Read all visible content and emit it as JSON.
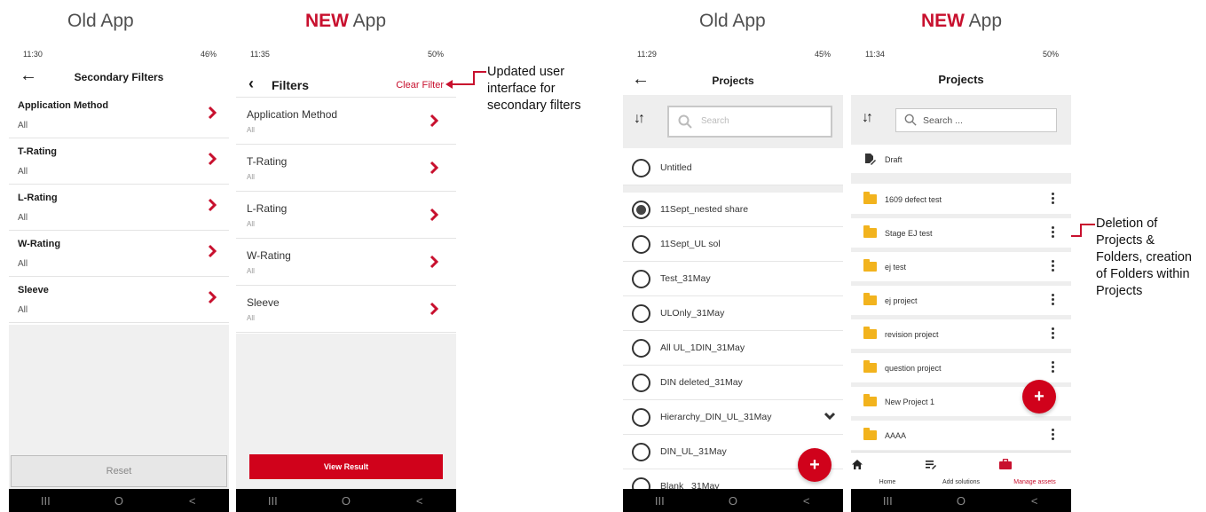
{
  "captions": {
    "c1": "Old App",
    "c2_new": "NEW",
    "c2_rest": " App",
    "c3": "Old App",
    "c4_new": "NEW",
    "c4_rest": " App"
  },
  "colors": {
    "accent": "#c8102e",
    "button_red": "#d0021b",
    "folder": "#f2b31d"
  },
  "old_filters": {
    "time": "11:30",
    "status_right": "46%",
    "title": "Secondary Filters",
    "items": [
      {
        "label": "Application Method",
        "value": "All"
      },
      {
        "label": "T-Rating",
        "value": "All"
      },
      {
        "label": "L-Rating",
        "value": "All"
      },
      {
        "label": "W-Rating",
        "value": "All"
      },
      {
        "label": "Sleeve",
        "value": "All"
      }
    ],
    "reset_label": "Reset"
  },
  "new_filters": {
    "time": "11:35",
    "status_right": "50%",
    "title": "Filters",
    "clear_label": "Clear Filter",
    "items": [
      {
        "label": "Application Method",
        "value": "All"
      },
      {
        "label": "T-Rating",
        "value": "All"
      },
      {
        "label": "L-Rating",
        "value": "All"
      },
      {
        "label": "W-Rating",
        "value": "All"
      },
      {
        "label": "Sleeve",
        "value": "All"
      }
    ],
    "view_result_label": "View Result"
  },
  "annotations": {
    "filters_note": [
      "Updated user",
      "interface for",
      "secondary filters"
    ],
    "projects_note": [
      "Deletion of",
      "Projects &",
      "Folders, creation",
      "of Folders within",
      "Projects"
    ]
  },
  "old_projects": {
    "time": "11:29",
    "status_right": "45%",
    "title": "Projects",
    "search_placeholder": "Search",
    "items": [
      {
        "label": "Untitled",
        "selected": false
      },
      {
        "label": "11Sept_nested share",
        "selected": true
      },
      {
        "label": "11Sept_UL sol",
        "selected": false
      },
      {
        "label": "Test_31May",
        "selected": false
      },
      {
        "label": "ULOnly_31May",
        "selected": false
      },
      {
        "label": "All UL_1DIN_31May",
        "selected": false
      },
      {
        "label": "DIN deleted_31May",
        "selected": false
      },
      {
        "label": "Hierarchy_DIN_UL_31May",
        "selected": false
      },
      {
        "label": "DIN_UL_31May",
        "selected": false
      },
      {
        "label": "Blank _31May",
        "selected": false
      }
    ],
    "fab_label": "+"
  },
  "new_projects": {
    "time": "11:34",
    "status_right": "50%",
    "title": "Projects",
    "search_placeholder": "Search ...",
    "draft_label": "Draft",
    "items": [
      {
        "label": "1609 defect test"
      },
      {
        "label": "Stage EJ test"
      },
      {
        "label": "ej test"
      },
      {
        "label": "ej project"
      },
      {
        "label": "revision project"
      },
      {
        "label": "question project"
      },
      {
        "label": "New Project 1"
      },
      {
        "label": "AAAA"
      }
    ],
    "fab_label": "+",
    "tabs": [
      {
        "label": "Home",
        "icon": "home-icon"
      },
      {
        "label": "Add solutions",
        "icon": "list-add-icon"
      },
      {
        "label": "Manage assets",
        "icon": "briefcase-icon"
      }
    ]
  },
  "navbar": {
    "recent": "III",
    "home": "O",
    "back": "<"
  }
}
